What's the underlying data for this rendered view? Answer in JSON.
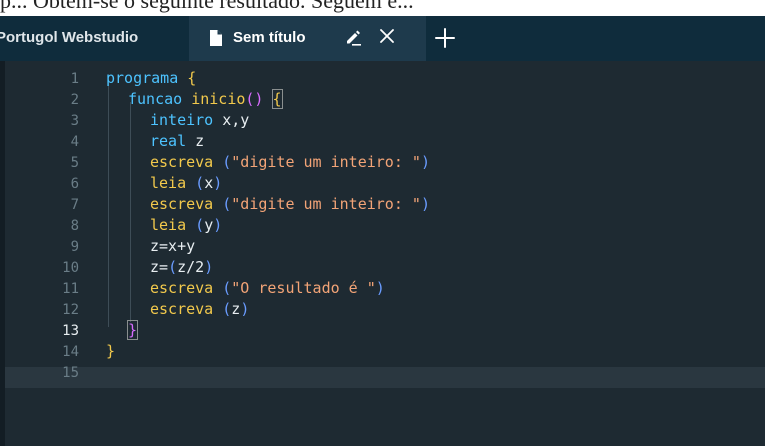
{
  "page_top_text": "p... Obtém-se o seguinte resultado. Seguem e...",
  "tabs": {
    "home_label": "Portugol Webstudio",
    "file_label": "Sem título",
    "file_icon": "file-icon",
    "rename_icon": "pencil-icon",
    "close_icon": "close-icon",
    "add_icon": "plus-icon"
  },
  "editor": {
    "active_line": 13,
    "line_numbers": [
      "1",
      "2",
      "3",
      "4",
      "5",
      "6",
      "7",
      "8",
      "9",
      "10",
      "11",
      "12",
      "13",
      "14",
      "15"
    ],
    "code": {
      "l1": {
        "kw": "programa",
        "brace": "{"
      },
      "l2": {
        "kw": "funcao",
        "fn": "inicio",
        "parens": "()",
        "brace": "{"
      },
      "l3": {
        "kw": "inteiro",
        "rest": " x,y"
      },
      "l4": {
        "kw": "real",
        "rest": " z"
      },
      "l5": {
        "fn": "escreva",
        "open": "(",
        "str": "\"digite um inteiro: \"",
        "close": ")"
      },
      "l6": {
        "fn": "leia",
        "open": "(",
        "arg": "x",
        "close": ")"
      },
      "l7": {
        "fn": "escreva",
        "open": "(",
        "str": "\"digite um inteiro: \"",
        "close": ")"
      },
      "l8": {
        "fn": "leia",
        "open": "(",
        "arg": "y",
        "close": ")"
      },
      "l9": {
        "text": "z=x+y"
      },
      "l10": {
        "pre": "z=",
        "open": "(",
        "arg": "z/2",
        "close": ")"
      },
      "l11": {
        "fn": "escreva",
        "open": "(",
        "str": "\"O resultado é \"",
        "close": ")"
      },
      "l12": {
        "fn": "escreva",
        "open": "(",
        "arg": "z",
        "close": ")"
      },
      "l13": {
        "brace": "}"
      },
      "l14": {
        "brace": "}"
      },
      "l15": {}
    }
  },
  "colors": {
    "tabbar": "#0f2c3c",
    "editor_bg": "#1e2a32",
    "keyword": "#4dc3ff",
    "function": "#f2c94c",
    "string": "#f3a477",
    "paren": "#6a9cff"
  }
}
